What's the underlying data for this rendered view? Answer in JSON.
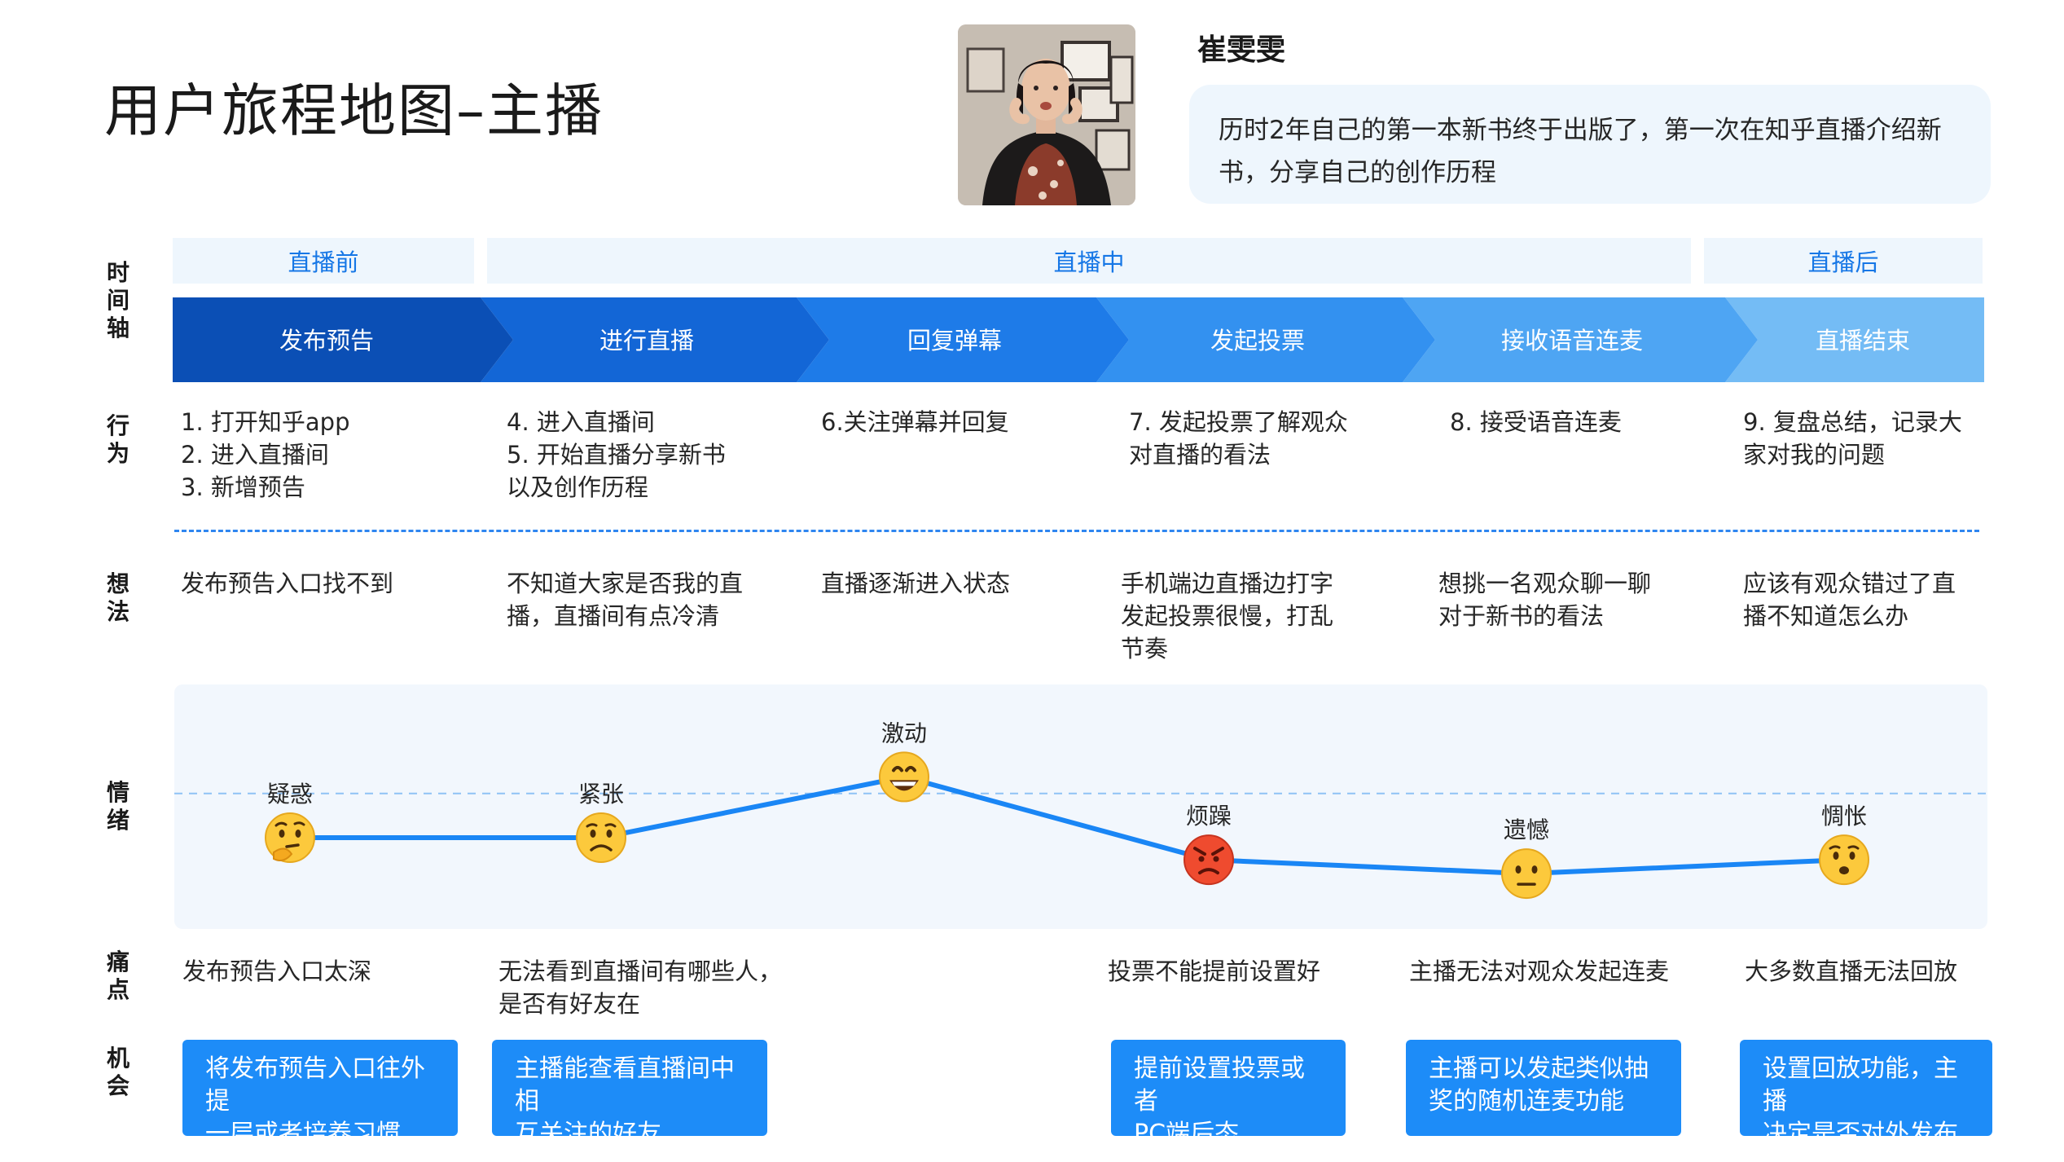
{
  "page": {
    "title": "用户旅程地图–主播"
  },
  "persona": {
    "name": "崔雯雯",
    "quote": "历时2年自己的第一本新书终于出版了，第一次在知乎直播介绍新书，分享自己的创作历程"
  },
  "row_labels": {
    "timeline": "时间轴",
    "behavior": "行为",
    "thoughts": "想法",
    "emotion": "情绪",
    "pain": "痛点",
    "opportunity": "机会"
  },
  "phases": [
    "直播前",
    "直播中",
    "直播后"
  ],
  "stages": [
    "发布预告",
    "进行直播",
    "回复弹幕",
    "发起投票",
    "接收语音连麦",
    "直播结束"
  ],
  "stage_colors": [
    "#0b4fb5",
    "#1366d6",
    "#1e7be8",
    "#3391f0",
    "#4ea5f3",
    "#74bcf5"
  ],
  "behaviors": [
    [
      "1. 打开知乎app",
      "2. 进入直播间",
      "3. 新增预告"
    ],
    [
      "4. 进入直播间",
      "5. 开始直播分享新书",
      "以及创作历程"
    ],
    [
      "6.关注弹幕并回复"
    ],
    [
      "7. 发起投票了解观众",
      "对直播的看法"
    ],
    [
      "8. 接受语音连麦"
    ],
    [
      "9. 复盘总结，记录大",
      "家对我的问题"
    ]
  ],
  "thoughts": [
    [
      "发布预告入口找不到"
    ],
    [
      "不知道大家是否我的直",
      "播，直播间有点冷清"
    ],
    [
      "直播逐渐进入状态"
    ],
    [
      "手机端边直播边打字",
      "发起投票很慢，打乱",
      "节奏"
    ],
    [
      "想挑一名观众聊一聊",
      "对于新书的看法"
    ],
    [
      "应该有观众错过了直",
      "播不知道怎么办"
    ]
  ],
  "chart_data": {
    "type": "line",
    "series": [
      {
        "labels": [
          "疑惑",
          "紧张",
          "激动",
          "烦躁",
          "遗憾",
          "惆怅"
        ],
        "icons": [
          "thinking-face-icon",
          "worried-face-icon",
          "grinning-face-icon",
          "angry-face-icon",
          "neutral-face-icon",
          "anxious-face-icon"
        ],
        "values": [
          0,
          0,
          1.1,
          -0.4,
          -0.65,
          -0.4
        ]
      }
    ],
    "baseline": 0.8,
    "ylim": [
      -1.6,
      2.8
    ],
    "line_color": "#1a86f5",
    "baseline_color": "#8fc2f5"
  },
  "pain_points": [
    [
      "发布预告入口太深"
    ],
    [
      "无法看到直播间有哪些人，",
      "是否有好友在"
    ],
    [
      ""
    ],
    [
      "投票不能提前设置好"
    ],
    [
      "主播无法对观众发起连麦"
    ],
    [
      "大多数直播无法回放"
    ]
  ],
  "opportunities": [
    [
      "将发布预告入口往外提",
      "一层或者培养习惯"
    ],
    [
      "主播能查看直播间中相",
      "互关注的好友"
    ],
    [
      "提前设置投票或者",
      "PC端后态"
    ],
    [
      "主播可以发起类似抽",
      "奖的随机连麦功能"
    ],
    [
      "设置回放功能，主播",
      "决定是否对外发布"
    ]
  ]
}
